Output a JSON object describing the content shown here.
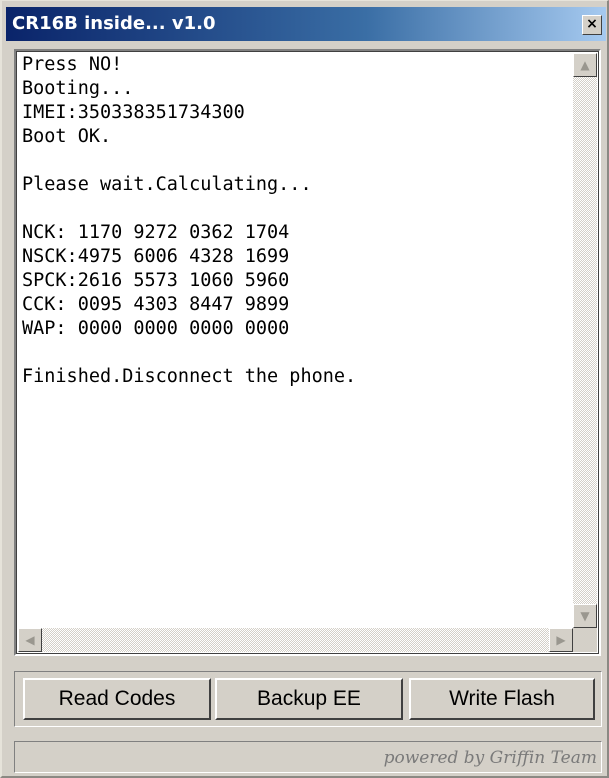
{
  "window": {
    "title": "CR16B inside... v1.0",
    "close_glyph": "×"
  },
  "console": {
    "text": "Press NO!\nBooting...\nIMEI:350338351734300\nBoot OK.\n\nPlease wait.Calculating...\n\nNCK: 1170 9272 0362 1704\nNSCK:4975 6006 4328 1699\nSPCK:2616 5573 1060 5960\nCCK: 0095 4303 8447 9899\nWAP: 0000 0000 0000 0000\n\nFinished.Disconnect the phone."
  },
  "scrollbar": {
    "up_glyph": "▲",
    "down_glyph": "▼",
    "left_glyph": "◀",
    "right_glyph": "▶"
  },
  "buttons": {
    "read_codes": "Read Codes",
    "backup_ee": "Backup EE",
    "write_flash": "Write Flash"
  },
  "status": {
    "text": "powered by Griffin Team"
  },
  "colors": {
    "title_start": "#0a246a",
    "title_end": "#a6caf0",
    "face": "#d4d0c8"
  }
}
